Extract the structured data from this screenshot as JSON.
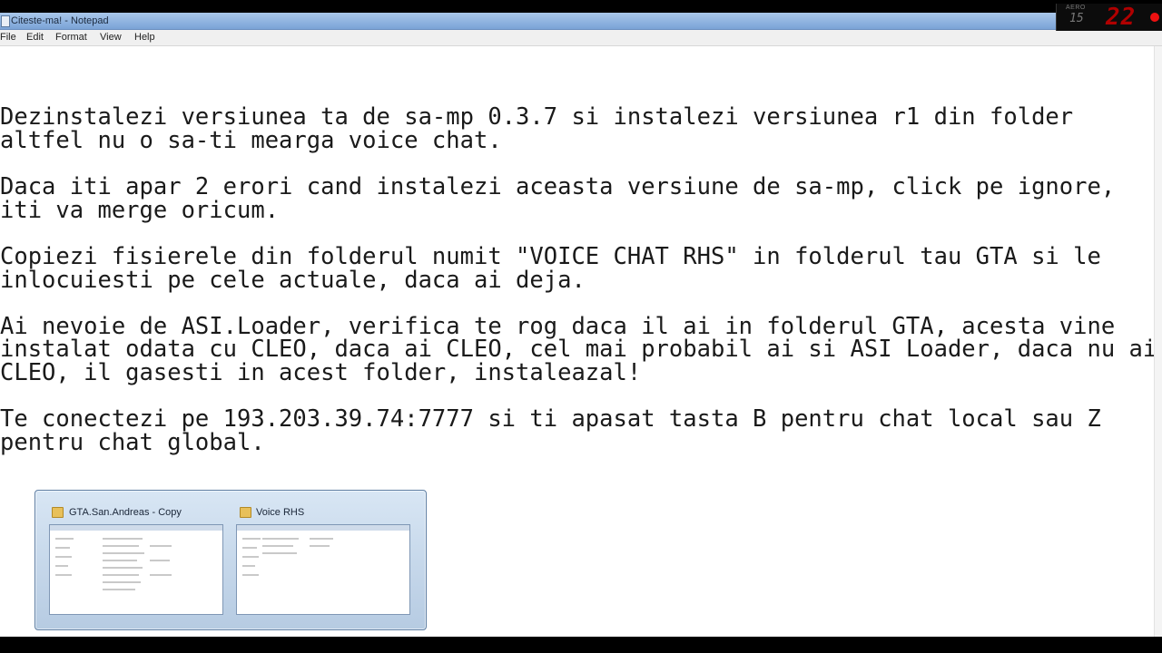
{
  "window": {
    "title": "Citeste-ma! - Notepad"
  },
  "menu": [
    "File",
    "Edit",
    "Format",
    "View",
    "Help"
  ],
  "hud": {
    "label": "AERO",
    "small": "15",
    "big": "22"
  },
  "document": {
    "lines": [
      "Dezinstalezi versiunea ta de sa-mp 0.3.7 si instalezi versiunea r1 din folder",
      "altfel nu o sa-ti mearga voice chat.",
      "Daca iti apar 2 erori cand instalezi aceasta versiune de sa-mp, click pe ignore,",
      "iti va merge oricum.",
      "Copiezi fisierele din folderul numit \"VOICE CHAT RHS\" in folderul tau GTA si le",
      "inlocuiesti pe cele actuale, daca ai deja.",
      "Ai nevoie de ASI.Loader, verifica te rog daca il ai in folderul GTA, acesta vine",
      "instalat odata cu CLEO, daca ai CLEO, cel mai probabil ai si ASI Loader, daca nu ai",
      "CLEO, il gasesti in acest folder, instaleazal!",
      "Te conectezi pe 193.203.39.74:7777 si ti apasat tasta B pentru chat local sau Z",
      "pentru chat global."
    ]
  },
  "taskbar_preview": {
    "items": [
      {
        "title": "GTA.San.Andreas - Copy",
        "icon": "folder-icon"
      },
      {
        "title": "Voice RHS",
        "icon": "folder-icon"
      }
    ]
  }
}
